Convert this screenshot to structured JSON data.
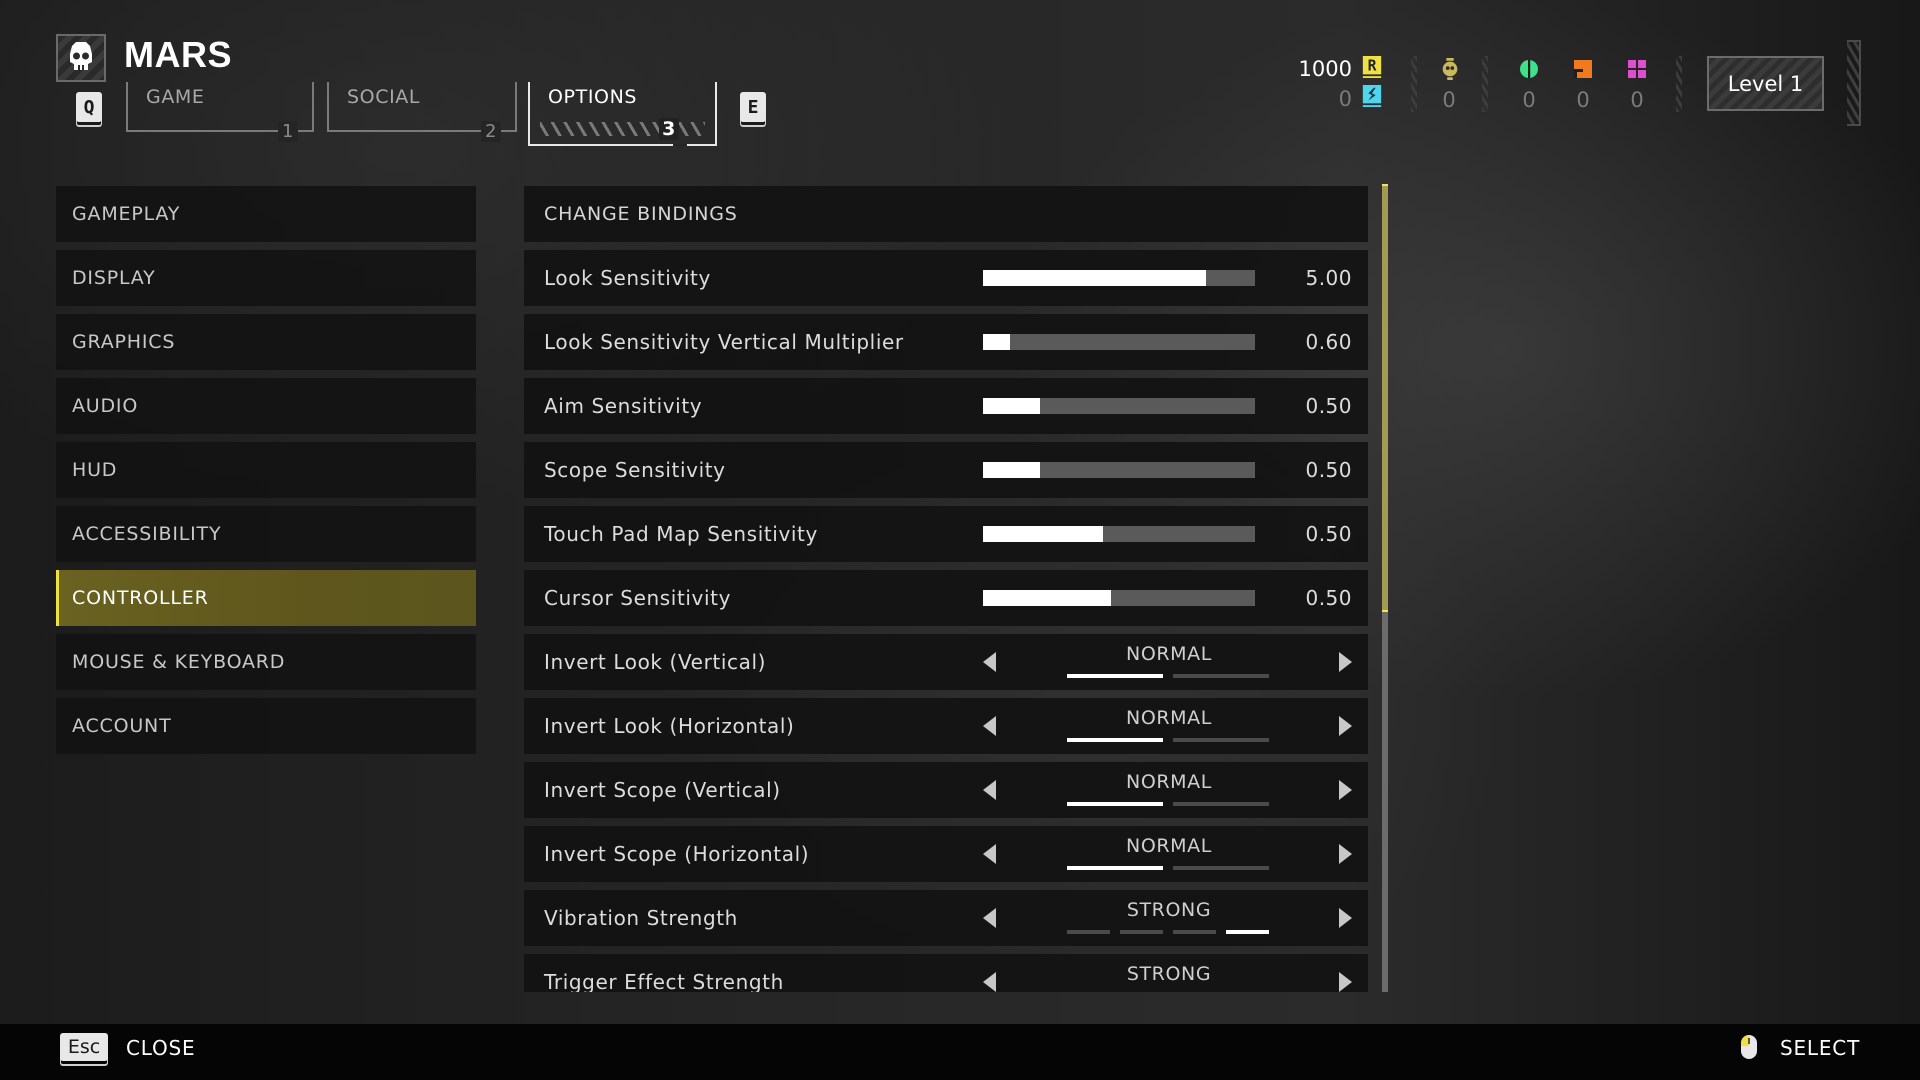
{
  "header": {
    "player_name": "MARS",
    "prev_tab_key": "Q",
    "next_tab_key": "E",
    "tabs": [
      {
        "label": "GAME",
        "number": "1",
        "active": false
      },
      {
        "label": "SOCIAL",
        "number": "2",
        "active": false
      },
      {
        "label": "OPTIONS",
        "number": "3",
        "active": true
      }
    ],
    "currencies": {
      "requisition": {
        "value": "1000",
        "icon": "requisition-r-icon",
        "color": "#f0e040"
      },
      "super_credits": {
        "value": "0",
        "icon": "super-credits-icon",
        "color": "#4fd6ee"
      },
      "medals": {
        "value": "0",
        "icon": "medal-icon",
        "color": "#c9b95a"
      },
      "common_samples": {
        "value": "0",
        "icon": "common-sample-icon",
        "color": "#3ee08a"
      },
      "rare_samples": {
        "value": "0",
        "icon": "rare-sample-icon",
        "color": "#f07a20"
      },
      "super_samples": {
        "value": "0",
        "icon": "super-sample-icon",
        "color": "#e04ed0"
      }
    },
    "level_label": "Level 1"
  },
  "menu": {
    "items": [
      {
        "label": "GAMEPLAY",
        "active": false
      },
      {
        "label": "DISPLAY",
        "active": false
      },
      {
        "label": "GRAPHICS",
        "active": false
      },
      {
        "label": "AUDIO",
        "active": false
      },
      {
        "label": "HUD",
        "active": false
      },
      {
        "label": "ACCESSIBILITY",
        "active": false
      },
      {
        "label": "CONTROLLER",
        "active": true
      },
      {
        "label": "MOUSE & KEYBOARD",
        "active": false
      },
      {
        "label": "ACCOUNT",
        "active": false
      }
    ],
    "accent_color": "#f0e040"
  },
  "settings": {
    "header_row": "CHANGE BINDINGS",
    "sliders": [
      {
        "label": "Look Sensitivity",
        "value": "5.00",
        "fill_fraction": 0.82
      },
      {
        "label": "Look Sensitivity Vertical Multiplier",
        "value": "0.60",
        "fill_fraction": 0.1
      },
      {
        "label": "Aim Sensitivity",
        "value": "0.50",
        "fill_fraction": 0.21
      },
      {
        "label": "Scope Sensitivity",
        "value": "0.50",
        "fill_fraction": 0.21
      },
      {
        "label": "Touch Pad Map Sensitivity",
        "value": "0.50",
        "fill_fraction": 0.44
      },
      {
        "label": "Cursor Sensitivity",
        "value": "0.50",
        "fill_fraction": 0.47
      }
    ],
    "selectors": [
      {
        "label": "Invert Look (Vertical)",
        "value": "NORMAL",
        "option_count": 2,
        "selected_index": 0
      },
      {
        "label": "Invert Look (Horizontal)",
        "value": "NORMAL",
        "option_count": 2,
        "selected_index": 0
      },
      {
        "label": "Invert Scope (Vertical)",
        "value": "NORMAL",
        "option_count": 2,
        "selected_index": 0
      },
      {
        "label": "Invert Scope (Horizontal)",
        "value": "NORMAL",
        "option_count": 2,
        "selected_index": 0
      },
      {
        "label": "Vibration Strength",
        "value": "STRONG",
        "option_count": 4,
        "selected_index": 3
      },
      {
        "label": "Trigger Effect Strength",
        "value": "STRONG",
        "option_count": 4,
        "selected_index": 3
      }
    ],
    "scroll_fraction_visible": 0.53
  },
  "footer": {
    "close_key": "Esc",
    "close_label": "CLOSE",
    "select_icon": "mouse-left-click-icon",
    "select_label": "SELECT"
  }
}
